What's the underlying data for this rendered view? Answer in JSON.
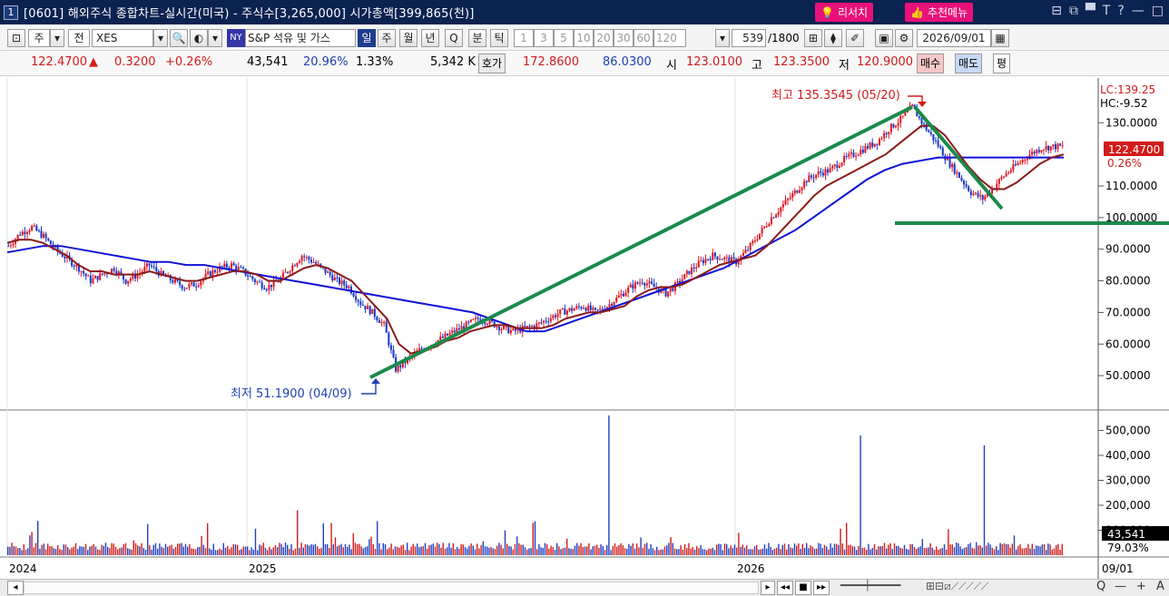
{
  "title": {
    "window_num": "1",
    "text": "[0601] 해외주식 종합차트-실시간(미국) - 주식수[3,265,000] 시가총액[399,865(천)]",
    "research": "리서치",
    "recommend": "추천메뉴"
  },
  "window_icons": [
    "⊟",
    "⧉",
    "▀",
    "T",
    "?",
    "—",
    "□"
  ],
  "toolbar": {
    "type_select": "주",
    "type2": "전",
    "symbol": "XES",
    "ny_badge": "NY",
    "name": "S&P 석유 및 가스",
    "periods": [
      "일",
      "주",
      "월",
      "년",
      "Q"
    ],
    "active_period": "일",
    "minute": "분",
    "tick": "틱",
    "intervals": [
      "1",
      "3",
      "5",
      "10",
      "20",
      "30",
      "60",
      "120"
    ],
    "count": "539",
    "total": "/1800",
    "date": "2026/09/01"
  },
  "quote": {
    "price": "122.4700",
    "change": "0.3200",
    "change_pct": "+0.26%",
    "volume": "43,541",
    "vol_ratio": "20.96%",
    "turnover": "1.33%",
    "unit_vol": "5,342 K",
    "hoga_label": "호가",
    "bid": "172.8600",
    "ask": "86.0300",
    "open_label": "시",
    "open": "123.0100",
    "high_label": "고",
    "high": "123.3500",
    "low_label": "저",
    "low": "120.9000",
    "buy": "매수",
    "sell": "매도",
    "flat": "평"
  },
  "annotations": {
    "high": "최고 135.3545 (05/20)",
    "low": "최저 51.1900 (04/09)"
  },
  "chart_data": {
    "type": "candlestick",
    "price_axis": {
      "ticks": [
        50,
        60,
        70,
        80,
        90,
        100,
        110,
        120,
        130
      ],
      "range": [
        42,
        143
      ],
      "labels": [
        "50.0000",
        "60.0000",
        "70.0000",
        "80.0000",
        "90.0000",
        "100.0000",
        "110.0000",
        "130.0000"
      ]
    },
    "price_labels": {
      "lc": "LC:139.25",
      "hc": "HC:-9.52",
      "last": "122.4700",
      "pct": "0.26%"
    },
    "volume_axis": {
      "ticks": [
        100000,
        200000,
        300000,
        400000,
        500000
      ],
      "labels": [
        "500,000",
        "400,000",
        "300,000",
        "200,000",
        "100,000"
      ],
      "range": [
        0,
        560000
      ],
      "last": "43,541",
      "last_pct": "79.03%"
    },
    "x_labels": [
      "2024",
      "2025",
      "2026",
      "09/01"
    ],
    "series": [
      {
        "name": "price",
        "values": [
          91,
          95,
          97,
          94,
          90,
          87,
          84,
          80,
          82,
          84,
          80,
          82,
          85,
          82,
          80,
          78,
          79,
          82,
          84,
          85,
          83,
          80,
          78,
          80,
          84,
          88,
          86,
          83,
          80,
          78,
          73,
          70,
          66,
          52,
          55,
          58,
          60,
          62,
          64,
          66,
          68,
          67,
          65,
          64,
          65,
          66,
          68,
          70,
          71,
          72,
          70,
          72,
          75,
          78,
          80,
          78,
          76,
          79,
          83,
          86,
          88,
          87,
          86,
          90,
          95,
          100,
          104,
          108,
          112,
          114,
          115,
          118,
          120,
          122,
          124,
          128,
          131,
          135,
          129,
          124,
          118,
          113,
          108,
          106,
          110,
          114,
          117,
          120,
          122,
          122.47
        ]
      },
      {
        "name": "ma-short",
        "values": [
          92,
          93,
          93,
          92,
          90,
          88,
          85,
          83,
          83,
          82,
          82,
          82,
          83,
          82,
          81,
          80,
          80,
          81,
          82,
          83,
          83,
          82,
          80,
          80,
          82,
          84,
          85,
          84,
          82,
          80,
          76,
          72,
          68,
          60,
          57,
          58,
          59,
          61,
          62,
          64,
          65,
          66,
          66,
          65,
          65,
          65,
          66,
          68,
          69,
          70,
          70,
          71,
          72,
          75,
          77,
          78,
          78,
          79,
          81,
          83,
          85,
          86,
          87,
          88,
          91,
          95,
          99,
          103,
          107,
          110,
          112,
          114,
          116,
          118,
          120,
          123,
          126,
          129,
          129,
          126,
          121,
          116,
          112,
          109,
          109,
          111,
          114,
          117,
          119,
          120
        ]
      },
      {
        "name": "ma-long",
        "values": [
          89,
          90,
          91,
          91,
          90,
          89,
          88,
          87,
          86,
          86,
          85,
          85,
          84,
          83,
          82,
          81,
          80,
          79,
          78,
          77,
          76,
          75,
          74,
          73,
          72,
          71,
          70,
          68,
          66,
          64,
          64,
          66,
          68,
          70,
          72,
          74,
          76,
          78,
          80,
          82,
          84,
          87,
          90,
          93,
          96,
          100,
          104,
          108,
          112,
          115,
          117,
          118,
          119,
          119,
          119,
          119,
          119,
          119,
          119,
          119
        ]
      }
    ],
    "trendlines": "up from 04/09 low to 05/20 high; down from high; horizontal support near 100"
  },
  "bottom": {
    "controls": [
      "◂",
      "▸",
      "◂◂",
      "■",
      "▸▸"
    ],
    "zoom": [
      "Q",
      "—",
      "+",
      "A"
    ]
  }
}
